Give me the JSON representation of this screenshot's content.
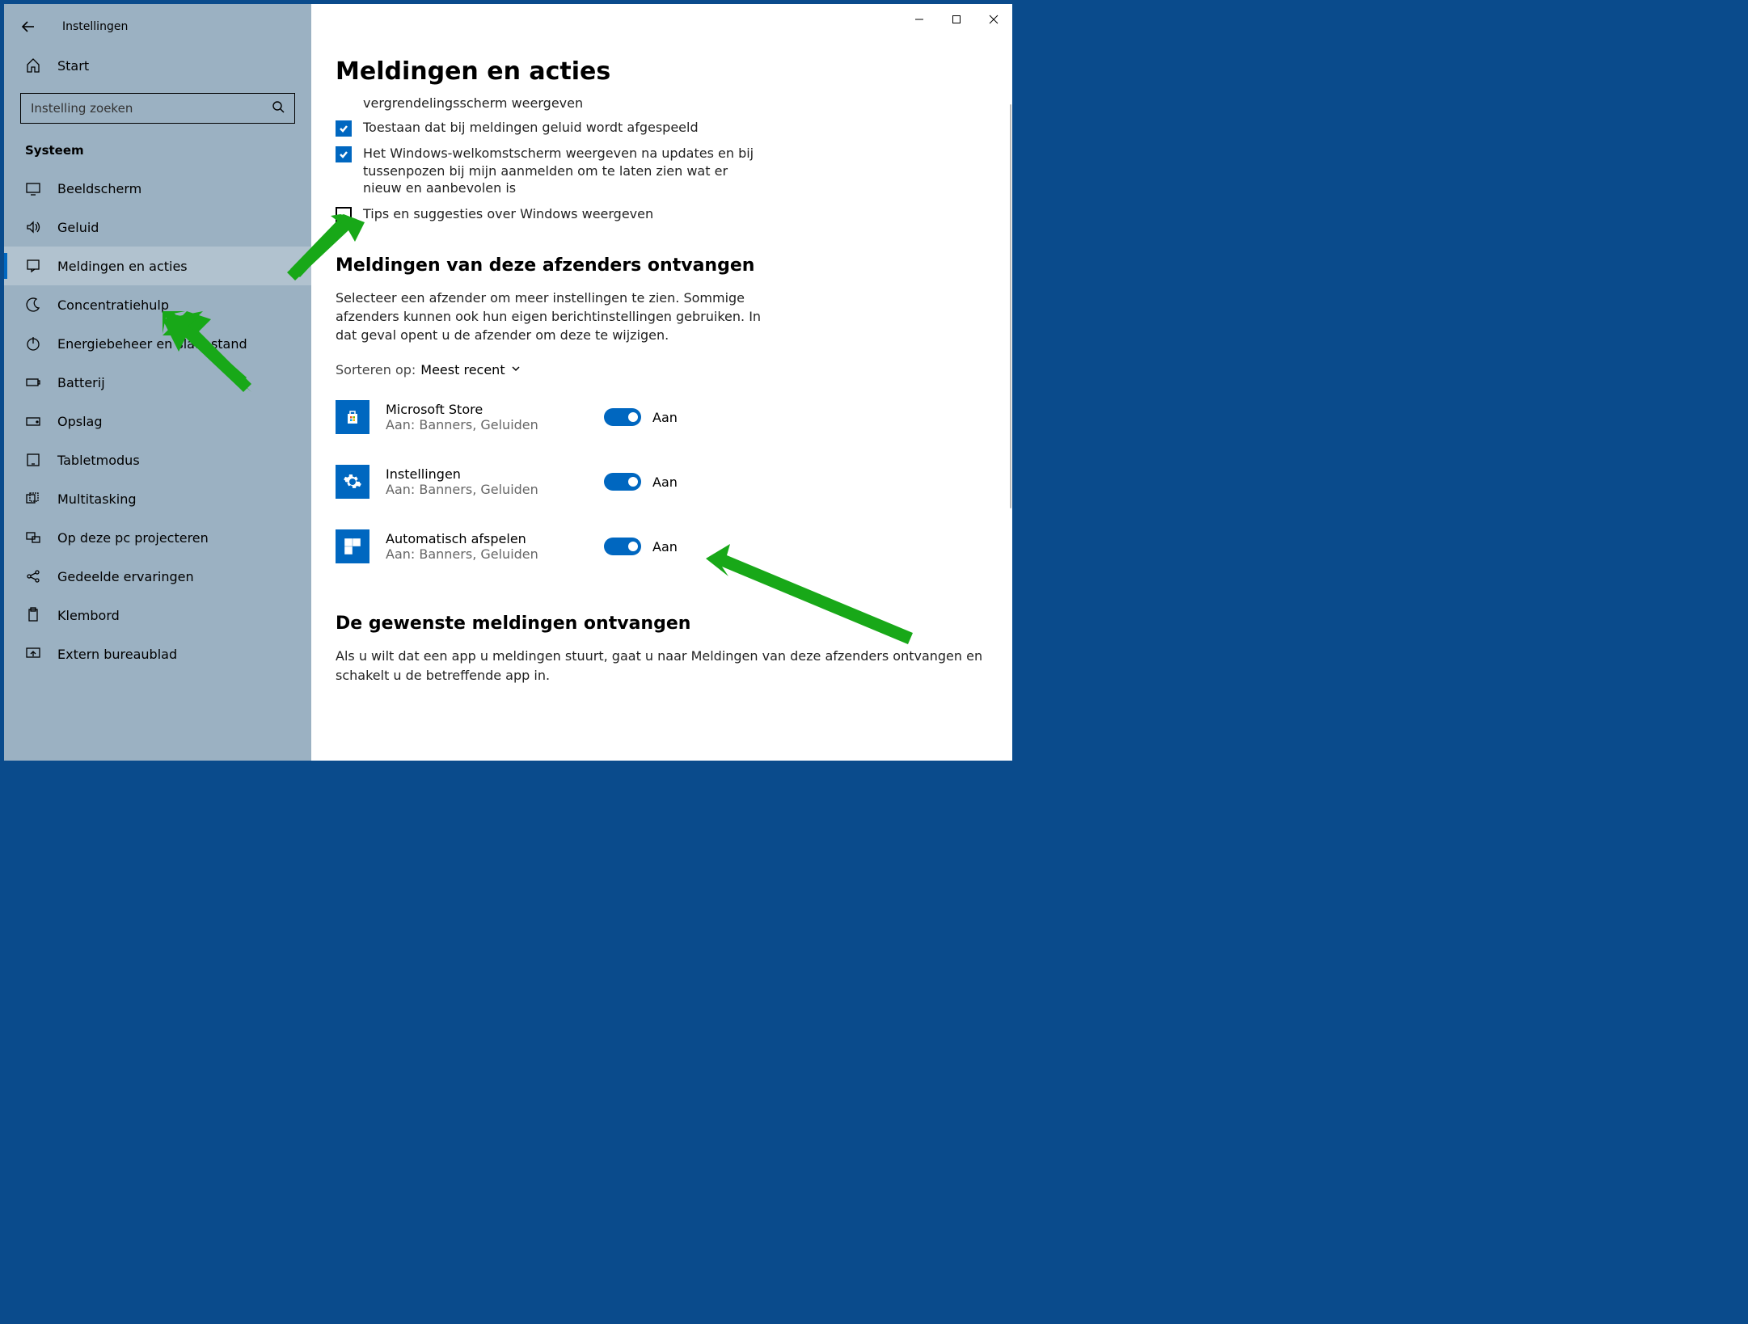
{
  "window_title": "Instellingen",
  "home_label": "Start",
  "search_placeholder": "Instelling zoeken",
  "sidebar_section": "Systeem",
  "sidebar": {
    "items": [
      {
        "label": "Beeldscherm"
      },
      {
        "label": "Geluid"
      },
      {
        "label": "Meldingen en acties"
      },
      {
        "label": "Concentratiehulp"
      },
      {
        "label": "Energiebeheer en slaapstand"
      },
      {
        "label": "Batterij"
      },
      {
        "label": "Opslag"
      },
      {
        "label": "Tabletmodus"
      },
      {
        "label": "Multitasking"
      },
      {
        "label": "Op deze pc projecteren"
      },
      {
        "label": "Gedeelde ervaringen"
      },
      {
        "label": "Klembord"
      },
      {
        "label": "Extern bureaublad"
      }
    ]
  },
  "page_title": "Meldingen en acties",
  "truncated_tail": "vergrendelingsscherm weergeven",
  "checks": [
    {
      "label": "Toestaan dat bij meldingen geluid wordt afgespeeld",
      "checked": true
    },
    {
      "label": "Het Windows-welkomstscherm weergeven na updates en bij tussenpozen bij mijn aanmelden om te laten zien wat er nieuw en aanbevolen is",
      "checked": true
    },
    {
      "label": "Tips en suggesties over Windows weergeven",
      "checked": false
    }
  ],
  "senders_heading": "Meldingen van deze afzenders ontvangen",
  "senders_body": "Selecteer een afzender om meer instellingen te zien. Sommige afzenders kunnen ook hun eigen berichtinstellingen gebruiken. In dat geval opent u de afzender om deze te wijzigen.",
  "sort_prefix": "Sorteren op:",
  "sort_value": "Meest recent",
  "toggle_on_label": "Aan",
  "senders": [
    {
      "name": "Microsoft Store",
      "sub": "Aan: Banners, Geluiden",
      "on": true
    },
    {
      "name": "Instellingen",
      "sub": "Aan: Banners, Geluiden",
      "on": true
    },
    {
      "name": "Automatisch afspelen",
      "sub": "Aan: Banners, Geluiden",
      "on": true
    }
  ],
  "footer_heading": "De gewenste meldingen ontvangen",
  "footer_body": "Als u wilt dat een app u meldingen stuurt, gaat u naar Meldingen van deze afzenders ontvangen en schakelt u de betreffende app in."
}
